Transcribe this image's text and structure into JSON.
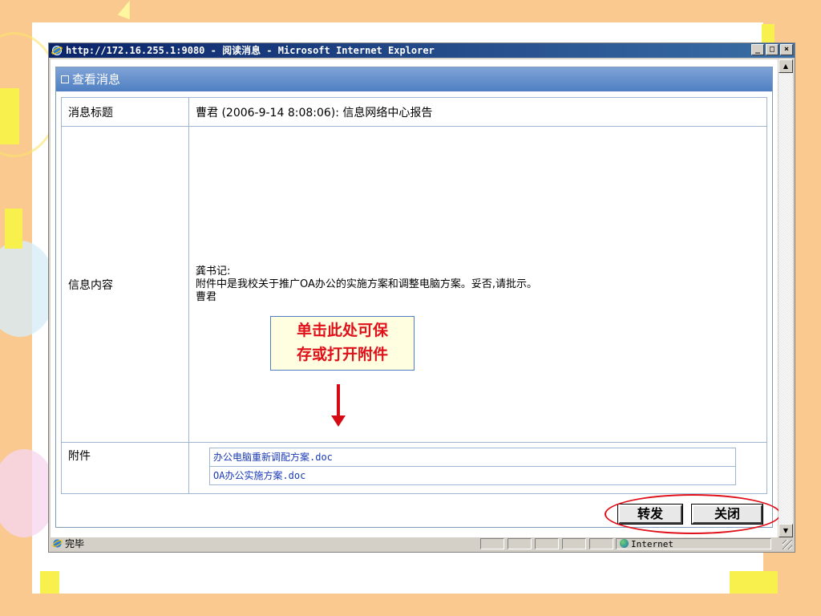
{
  "window": {
    "title": "http://172.16.255.1:9080 - 阅读消息 - Microsoft Internet Explorer",
    "minimize_glyph": "_",
    "maximize_glyph": "□",
    "close_glyph": "×"
  },
  "panel": {
    "title": "查看消息"
  },
  "message": {
    "title_label": "消息标题",
    "title_value": "曹君 (2006-9-14 8:08:06): 信息网络中心报告",
    "content_label": "信息内容",
    "content_lines": [
      "龚书记:",
      "附件中是我校关于推广OA办公的实施方案和调整电脑方案。妥否,请批示。",
      "曹君"
    ],
    "attachment_label": "附件",
    "attachments": [
      "办公电脑重新调配方案.doc",
      "OA办公实施方案.doc"
    ]
  },
  "callout": {
    "line1": "单击此处可保",
    "line2": "存或打开附件"
  },
  "buttons": {
    "forward": "转发",
    "close": "关闭"
  },
  "statusbar": {
    "status": "完毕",
    "zone": "Internet"
  },
  "colors": {
    "slide_background": "#f9c98f",
    "titlebar": "#0a246a",
    "panel_header": "#4f7fc2",
    "annotation_red": "#e0101a"
  }
}
